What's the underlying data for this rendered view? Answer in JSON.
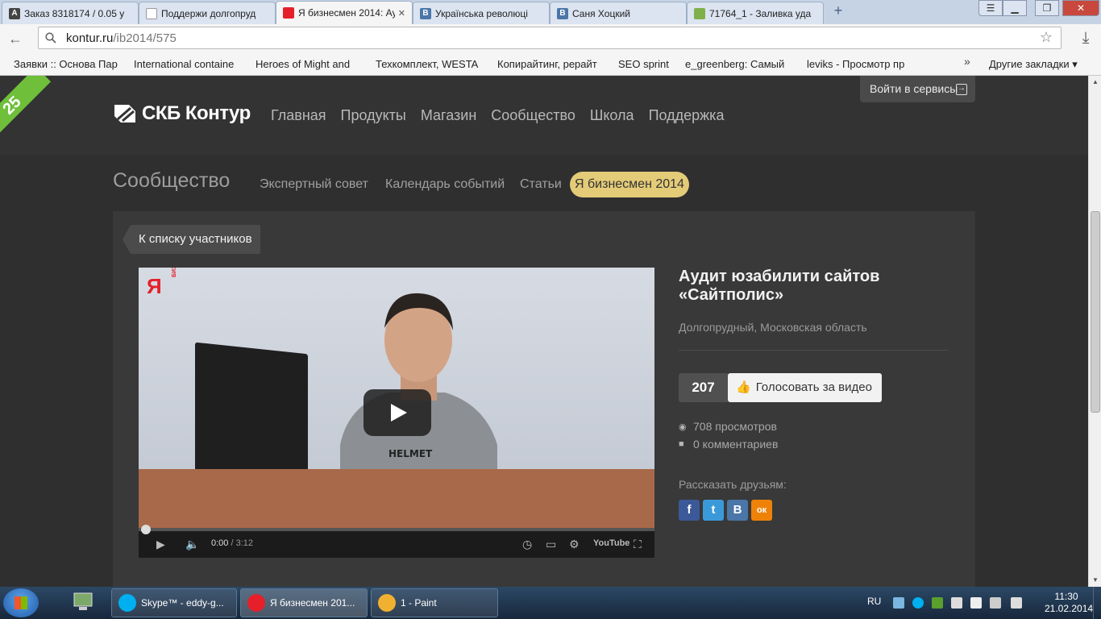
{
  "browser": {
    "tabs": [
      {
        "title": "Заказ 8318174 / 0.05 у",
        "favicon": "A",
        "color": "#444444",
        "active": false
      },
      {
        "title": "Поддержи долгопруд",
        "favicon": "",
        "color": "#ffffff",
        "active": false
      },
      {
        "title": "Я бизнесмен 2014: Ау",
        "favicon": "",
        "color": "#e5202a",
        "active": true
      },
      {
        "title": "Українська революці",
        "favicon": "B",
        "color": "#4a76a8",
        "active": false
      },
      {
        "title": "Саня Хоцкий",
        "favicon": "B",
        "color": "#4a76a8",
        "active": false
      },
      {
        "title": "71764_1 - Заливка уда",
        "favicon": "",
        "color": "#7fb04a",
        "active": false
      }
    ],
    "url_host": "kontur.ru",
    "url_path": "/ib2014/575",
    "bookmarks": [
      "Заявки :: Основа Пар",
      "International containe",
      "Heroes of Might and",
      "Техкомплект, WESTA",
      "Копирайтинг, рерайт",
      "SEO sprint",
      "e_greenberg: Самый",
      "leviks - Просмотр пр"
    ],
    "bookmarks_more": "»",
    "other_bookmarks": "Другие закладки ▾"
  },
  "site": {
    "anniversary": "25",
    "logo_text": "СКБ Контур",
    "nav": [
      "Главная",
      "Продукты",
      "Магазин",
      "Сообщество",
      "Школа",
      "Поддержка"
    ],
    "login_label": "Войти в сервисы",
    "section_title": "Сообщество",
    "subnav": [
      "Экспертный совет",
      "Календарь событий",
      "Статьи"
    ],
    "subnav_active": "Я бизнесмен 2014",
    "back_to_list": "К списку участников"
  },
  "video": {
    "brand_letter": "Я",
    "brand_sub": "БИЗНЕСМЕН",
    "time_current": "0:00",
    "time_duration": "/ 3:12",
    "youtube_label": "YouTube",
    "progress": 0
  },
  "entry": {
    "title": "Аудит юзабилити сайтов «Сайтполис»",
    "location": "Долгопрудный, Московская область",
    "vote_count": "207",
    "vote_label": "Голосовать за видео",
    "views": "708 просмотров",
    "comments": "0 комментариев",
    "share_label": "Рассказать друзьям:",
    "shares": [
      {
        "name": "facebook",
        "glyph": "f",
        "color": "#3b5998"
      },
      {
        "name": "twitter",
        "glyph": "t",
        "color": "#3a9ad9"
      },
      {
        "name": "vkontakte",
        "glyph": "B",
        "color": "#4a76a8"
      },
      {
        "name": "odnoklassniki",
        "glyph": "ок",
        "color": "#ee8208"
      }
    ]
  },
  "taskbar": {
    "items": [
      {
        "label": "Skype™ - eddy-g...",
        "color": "#00aff0"
      },
      {
        "label": "Я бизнесмен 201...",
        "color": "#e5202a"
      },
      {
        "label": "1 - Paint",
        "color": "#f0b030"
      }
    ],
    "lang": "RU",
    "time": "11:30",
    "date": "21.02.2014"
  }
}
